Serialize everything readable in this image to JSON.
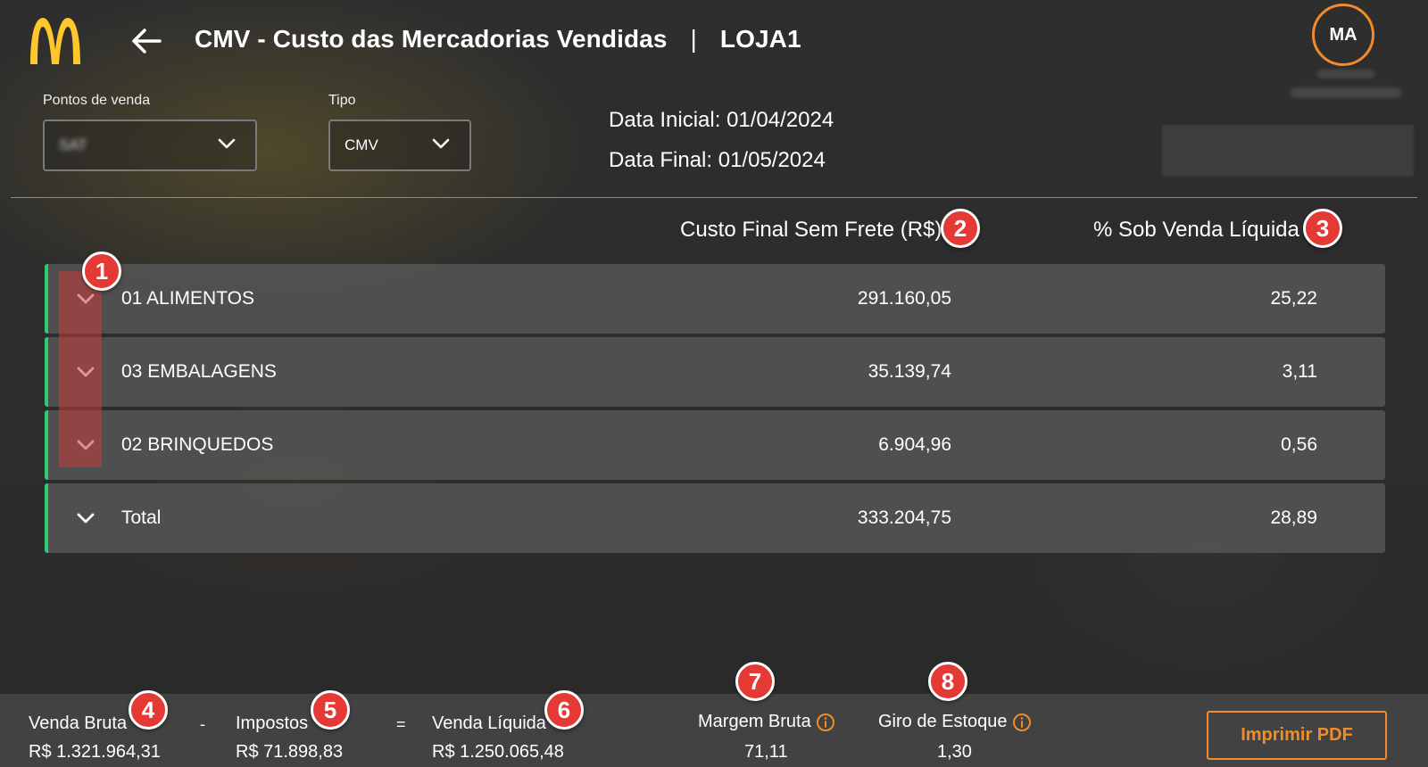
{
  "header": {
    "title": "CMV - Custo das Mercadorias Vendidas",
    "separator": "|",
    "store": "LOJA1",
    "avatar_initials": "MA",
    "brand_color": "#ffc72c",
    "accent_color": "#f28c28"
  },
  "filters": {
    "pdv_label": "Pontos de venda",
    "pdv_value": "SAT",
    "tipo_label": "Tipo",
    "tipo_value": "CMV"
  },
  "dates": {
    "initial_label": "Data Inicial:",
    "initial_value": "01/04/2024",
    "final_label": "Data Final:",
    "final_value": "01/05/2024"
  },
  "table": {
    "col_cost": "Custo Final Sem Frete (R$)",
    "col_pct": "% Sob Venda Líquida",
    "rows": [
      {
        "name": "01 ALIMENTOS",
        "cost": "291.160,05",
        "pct": "25,22"
      },
      {
        "name": "03 EMBALAGENS",
        "cost": "35.139,74",
        "pct": "3,11"
      },
      {
        "name": "02 BRINQUEDOS",
        "cost": "6.904,96",
        "pct": "0,56"
      },
      {
        "name": "Total",
        "cost": "333.204,75",
        "pct": "28,89"
      }
    ]
  },
  "badges": [
    "1",
    "2",
    "3",
    "4",
    "5",
    "6",
    "7",
    "8"
  ],
  "footer": {
    "venda_bruta_label": "Venda Bruta",
    "venda_bruta_value": "R$ 1.321.964,31",
    "minus": "-",
    "impostos_label": "Impostos",
    "impostos_value": "R$ 71.898,83",
    "equals": "=",
    "venda_liquida_label": "Venda Líquida",
    "venda_liquida_value": "R$ 1.250.065,48",
    "margem_label": "Margem Bruta",
    "margem_value": "71,11",
    "giro_label": "Giro de Estoque",
    "giro_value": "1,30",
    "pdf_button": "Imprimir PDF"
  }
}
